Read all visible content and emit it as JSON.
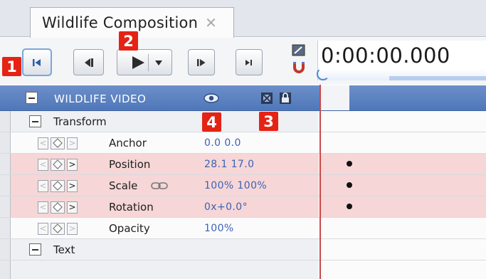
{
  "tab": {
    "title": "Wildlife Composition",
    "close_glyph": "✕"
  },
  "transport": {
    "buttons": [
      "first-frame-icon",
      "step-back-icon",
      "play-icon",
      "step-forward-icon",
      "last-frame-icon"
    ],
    "timecode": "0:00:00.000"
  },
  "layer": {
    "title": "WILDLIFE VIDEO",
    "icons": [
      "eye-icon",
      "film-icon",
      "lock-icon"
    ]
  },
  "groups": {
    "transform": "Transform",
    "text": "Text"
  },
  "properties": [
    {
      "name": "Anchor",
      "value": "0.0  0.0",
      "keyframe": false
    },
    {
      "name": "Position",
      "value": "28.1  17.0",
      "keyframe": true
    },
    {
      "name": "Scale",
      "value": "100%  100%",
      "keyframe": true,
      "link_icon": "chain-link-icon"
    },
    {
      "name": "Rotation",
      "value": "0x+0.0°",
      "keyframe": true
    },
    {
      "name": "Opacity",
      "value": "100%",
      "keyframe": false
    }
  ],
  "callouts": [
    "1",
    "2",
    "3",
    "4"
  ],
  "colors": {
    "callout": "#e42314",
    "header": "#5a80c0",
    "keyframe_row": "#f6d6d6",
    "value_text": "#3a64b6",
    "playhead": "#c84a4a"
  }
}
